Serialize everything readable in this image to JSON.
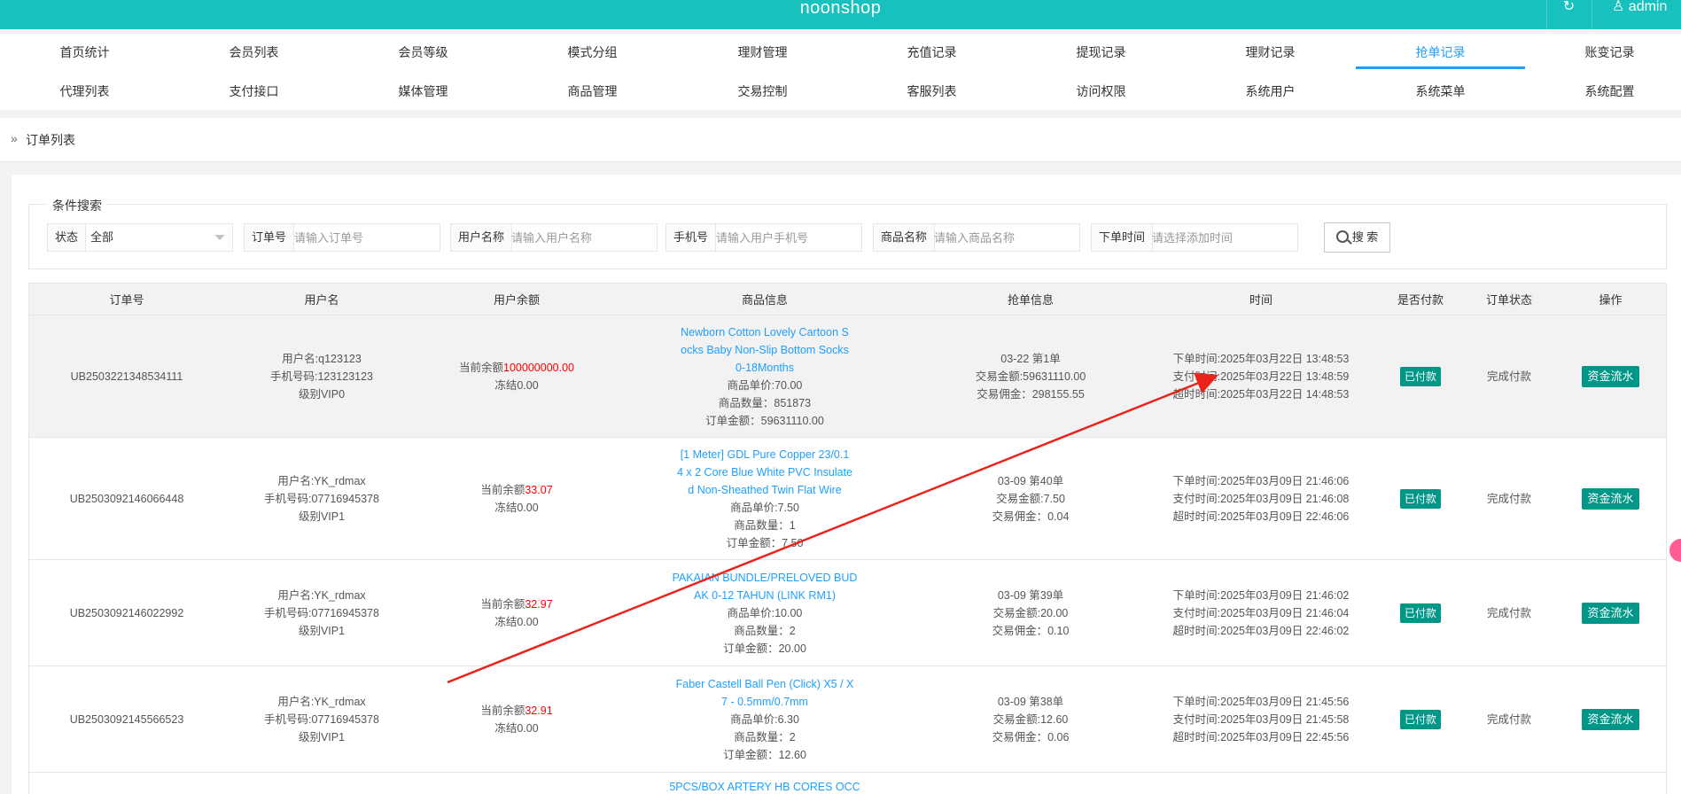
{
  "topbar": {
    "brand": "noonshop",
    "refresh_icon": "↻",
    "admin_label": "admin"
  },
  "nav": {
    "row1": [
      "首页统计",
      "会员列表",
      "会员等级",
      "模式分组",
      "理财管理",
      "充值记录",
      "提现记录",
      "理财记录",
      "抢单记录",
      "账变记录"
    ],
    "row2": [
      "代理列表",
      "支付接口",
      "媒体管理",
      "商品管理",
      "交易控制",
      "客服列表",
      "访问权限",
      "系统用户",
      "系统菜单",
      "系统配置"
    ],
    "active": "抢单记录"
  },
  "breadcrumb": {
    "chevron": "»",
    "label": "订单列表"
  },
  "search": {
    "legend": "条件搜索",
    "status_label": "状态",
    "status_value": "全部",
    "order_label": "订单号",
    "order_placeholder": "请输入订单号",
    "user_label": "用户名称",
    "user_placeholder": "请输入用户名称",
    "phone_label": "手机号",
    "phone_placeholder": "请输入用户手机号",
    "goods_label": "商品名称",
    "goods_placeholder": "请输入商品名称",
    "time_label": "下单时间",
    "time_placeholder": "请选择添加时间",
    "button": "搜 索"
  },
  "table": {
    "headers": [
      "订单号",
      "用户名",
      "用户余额",
      "商品信息",
      "抢单信息",
      "时间",
      "是否付款",
      "订单状态",
      "操作"
    ],
    "rows": [
      {
        "order_no": "UB2503221348534111",
        "user": [
          "用户名:q123123",
          "手机号码:123123123",
          "级别VIP0"
        ],
        "balance_label": "当前余额",
        "balance": "100000000.00",
        "frozen": "冻结0.00",
        "goods_title": [
          "Newborn Cotton Lovely Cartoon S",
          "ocks Baby Non-Slip Bottom Socks",
          "0-18Months"
        ],
        "goods_info": [
          "商品单价:70.00",
          "商品数量：851873",
          "订单金额：59631110.00"
        ],
        "grab": [
          "03-22 第1单",
          "交易金额:59631110.00",
          "交易佣金：298155.55"
        ],
        "time": [
          "下单时间:2025年03月22日 13:48:53",
          "支付时间:2025年03月22日 13:48:59",
          "超时时间:2025年03月22日 14:48:53"
        ],
        "paid": "已付款",
        "status": "完成付款",
        "action": "资金流水"
      },
      {
        "order_no": "UB2503092146066448",
        "user": [
          "用户名:YK_rdmax",
          "手机号码:07716945378",
          "级别VIP1"
        ],
        "balance_label": "当前余额",
        "balance": "33.07",
        "frozen": "冻结0.00",
        "goods_title": [
          "[1 Meter] GDL Pure Copper 23/0.1",
          "4 x 2 Core Blue White PVC Insulate",
          "d Non-Sheathed Twin Flat Wire"
        ],
        "goods_info": [
          "商品单价:7.50",
          "商品数量：1",
          "订单金额：7.50"
        ],
        "grab": [
          "03-09 第40单",
          "交易金额:7.50",
          "交易佣金：0.04"
        ],
        "time": [
          "下单时间:2025年03月09日 21:46:06",
          "支付时间:2025年03月09日 21:46:08",
          "超时时间:2025年03月09日 22:46:06"
        ],
        "paid": "已付款",
        "status": "完成付款",
        "action": "资金流水"
      },
      {
        "order_no": "UB2503092146022992",
        "user": [
          "用户名:YK_rdmax",
          "手机号码:07716945378",
          "级别VIP1"
        ],
        "balance_label": "当前余额",
        "balance": "32.97",
        "frozen": "冻结0.00",
        "goods_title": [
          "PAKAIAN BUNDLE/PRELOVED BUD",
          "AK 0-12 TAHUN (LINK RM1)"
        ],
        "goods_info": [
          "商品单价:10.00",
          "商品数量：2",
          "订单金额：20.00"
        ],
        "grab": [
          "03-09 第39单",
          "交易金额:20.00",
          "交易佣金：0.10"
        ],
        "time": [
          "下单时间:2025年03月09日 21:46:02",
          "支付时间:2025年03月09日 21:46:04",
          "超时时间:2025年03月09日 22:46:02"
        ],
        "paid": "已付款",
        "status": "完成付款",
        "action": "资金流水"
      },
      {
        "order_no": "UB2503092145566523",
        "user": [
          "用户名:YK_rdmax",
          "手机号码:07716945378",
          "级别VIP1"
        ],
        "balance_label": "当前余额",
        "balance": "32.91",
        "frozen": "冻结0.00",
        "goods_title": [
          "Faber Castell Ball Pen (Click) X5 / X",
          "7 - 0.5mm/0.7mm"
        ],
        "goods_info": [
          "商品单价:6.30",
          "商品数量：2",
          "订单金额：12.60"
        ],
        "grab": [
          "03-09 第38单",
          "交易金额:12.60",
          "交易佣金：0.06"
        ],
        "time": [
          "下单时间:2025年03月09日 21:45:56",
          "支付时间:2025年03月09日 21:45:58",
          "超时时间:2025年03月09日 22:45:56"
        ],
        "paid": "已付款",
        "status": "完成付款",
        "action": "资金流水"
      },
      {
        "goods_title": [
          "5PCS/BOX ARTERY HB CORES OCC"
        ]
      }
    ]
  },
  "colors": {
    "topbar": "#17c1bd",
    "active": "#1e9fff",
    "badge": "#009688",
    "balance": "#ff0000",
    "arrow": "#e8231a"
  }
}
